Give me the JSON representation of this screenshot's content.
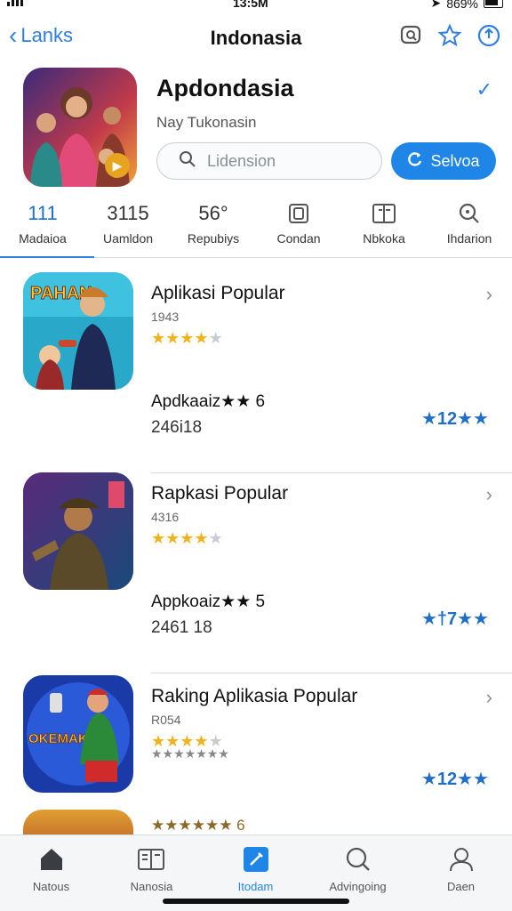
{
  "status": {
    "time": "13:5M",
    "battery": "869%"
  },
  "nav": {
    "back_label": "Lanks",
    "title": "Indonasia"
  },
  "header_app": {
    "name": "Apdondasia",
    "subtitle": "Nay Tukonasin",
    "search_placeholder": "Lidension",
    "button_label": "Selvoa"
  },
  "stats": [
    {
      "value": "111",
      "label": "Madaioa",
      "active": true
    },
    {
      "value": "3115",
      "label": "Uamldon"
    },
    {
      "value": "56°",
      "label": "Repubiys"
    },
    {
      "value": "",
      "label": "Condan",
      "icon": "content-icon"
    },
    {
      "value": "",
      "label": "Nbkoka",
      "icon": "book-icon"
    },
    {
      "value": "",
      "label": "Ihdarion",
      "icon": "search-icon"
    }
  ],
  "list": [
    {
      "title": "Aplikasi Popular",
      "number": "1943",
      "stars": 3.5,
      "sub1": "Apdkaaiz★★ 6",
      "sub2": "246i18",
      "rating_text": "★12★★"
    },
    {
      "title": "Rapkasi Popular",
      "number": "4316",
      "stars": 3.5,
      "sub1": "Appkoaiz★★ 5",
      "sub2": "2461 18",
      "rating_text": "★†7★★"
    },
    {
      "title": "Raking Aplikasia Popular",
      "number": "R054",
      "stars": 3.5,
      "sub1": "★★★★★★★",
      "sub2": "",
      "rating_text": "★12★★"
    }
  ],
  "partial_row": {
    "sub1": "★★★★★★ 6"
  },
  "tabs": [
    {
      "label": "Natous",
      "icon": "home-icon"
    },
    {
      "label": "Nanosia",
      "icon": "book-icon"
    },
    {
      "label": "Itodam",
      "icon": "edit-icon",
      "active": true
    },
    {
      "label": "Advingoing",
      "icon": "search-icon"
    },
    {
      "label": "Daen",
      "icon": "profile-icon"
    }
  ],
  "colors": {
    "accent": "#1f86e8",
    "star": "#f2b21c",
    "rating": "#1f6fc8"
  }
}
